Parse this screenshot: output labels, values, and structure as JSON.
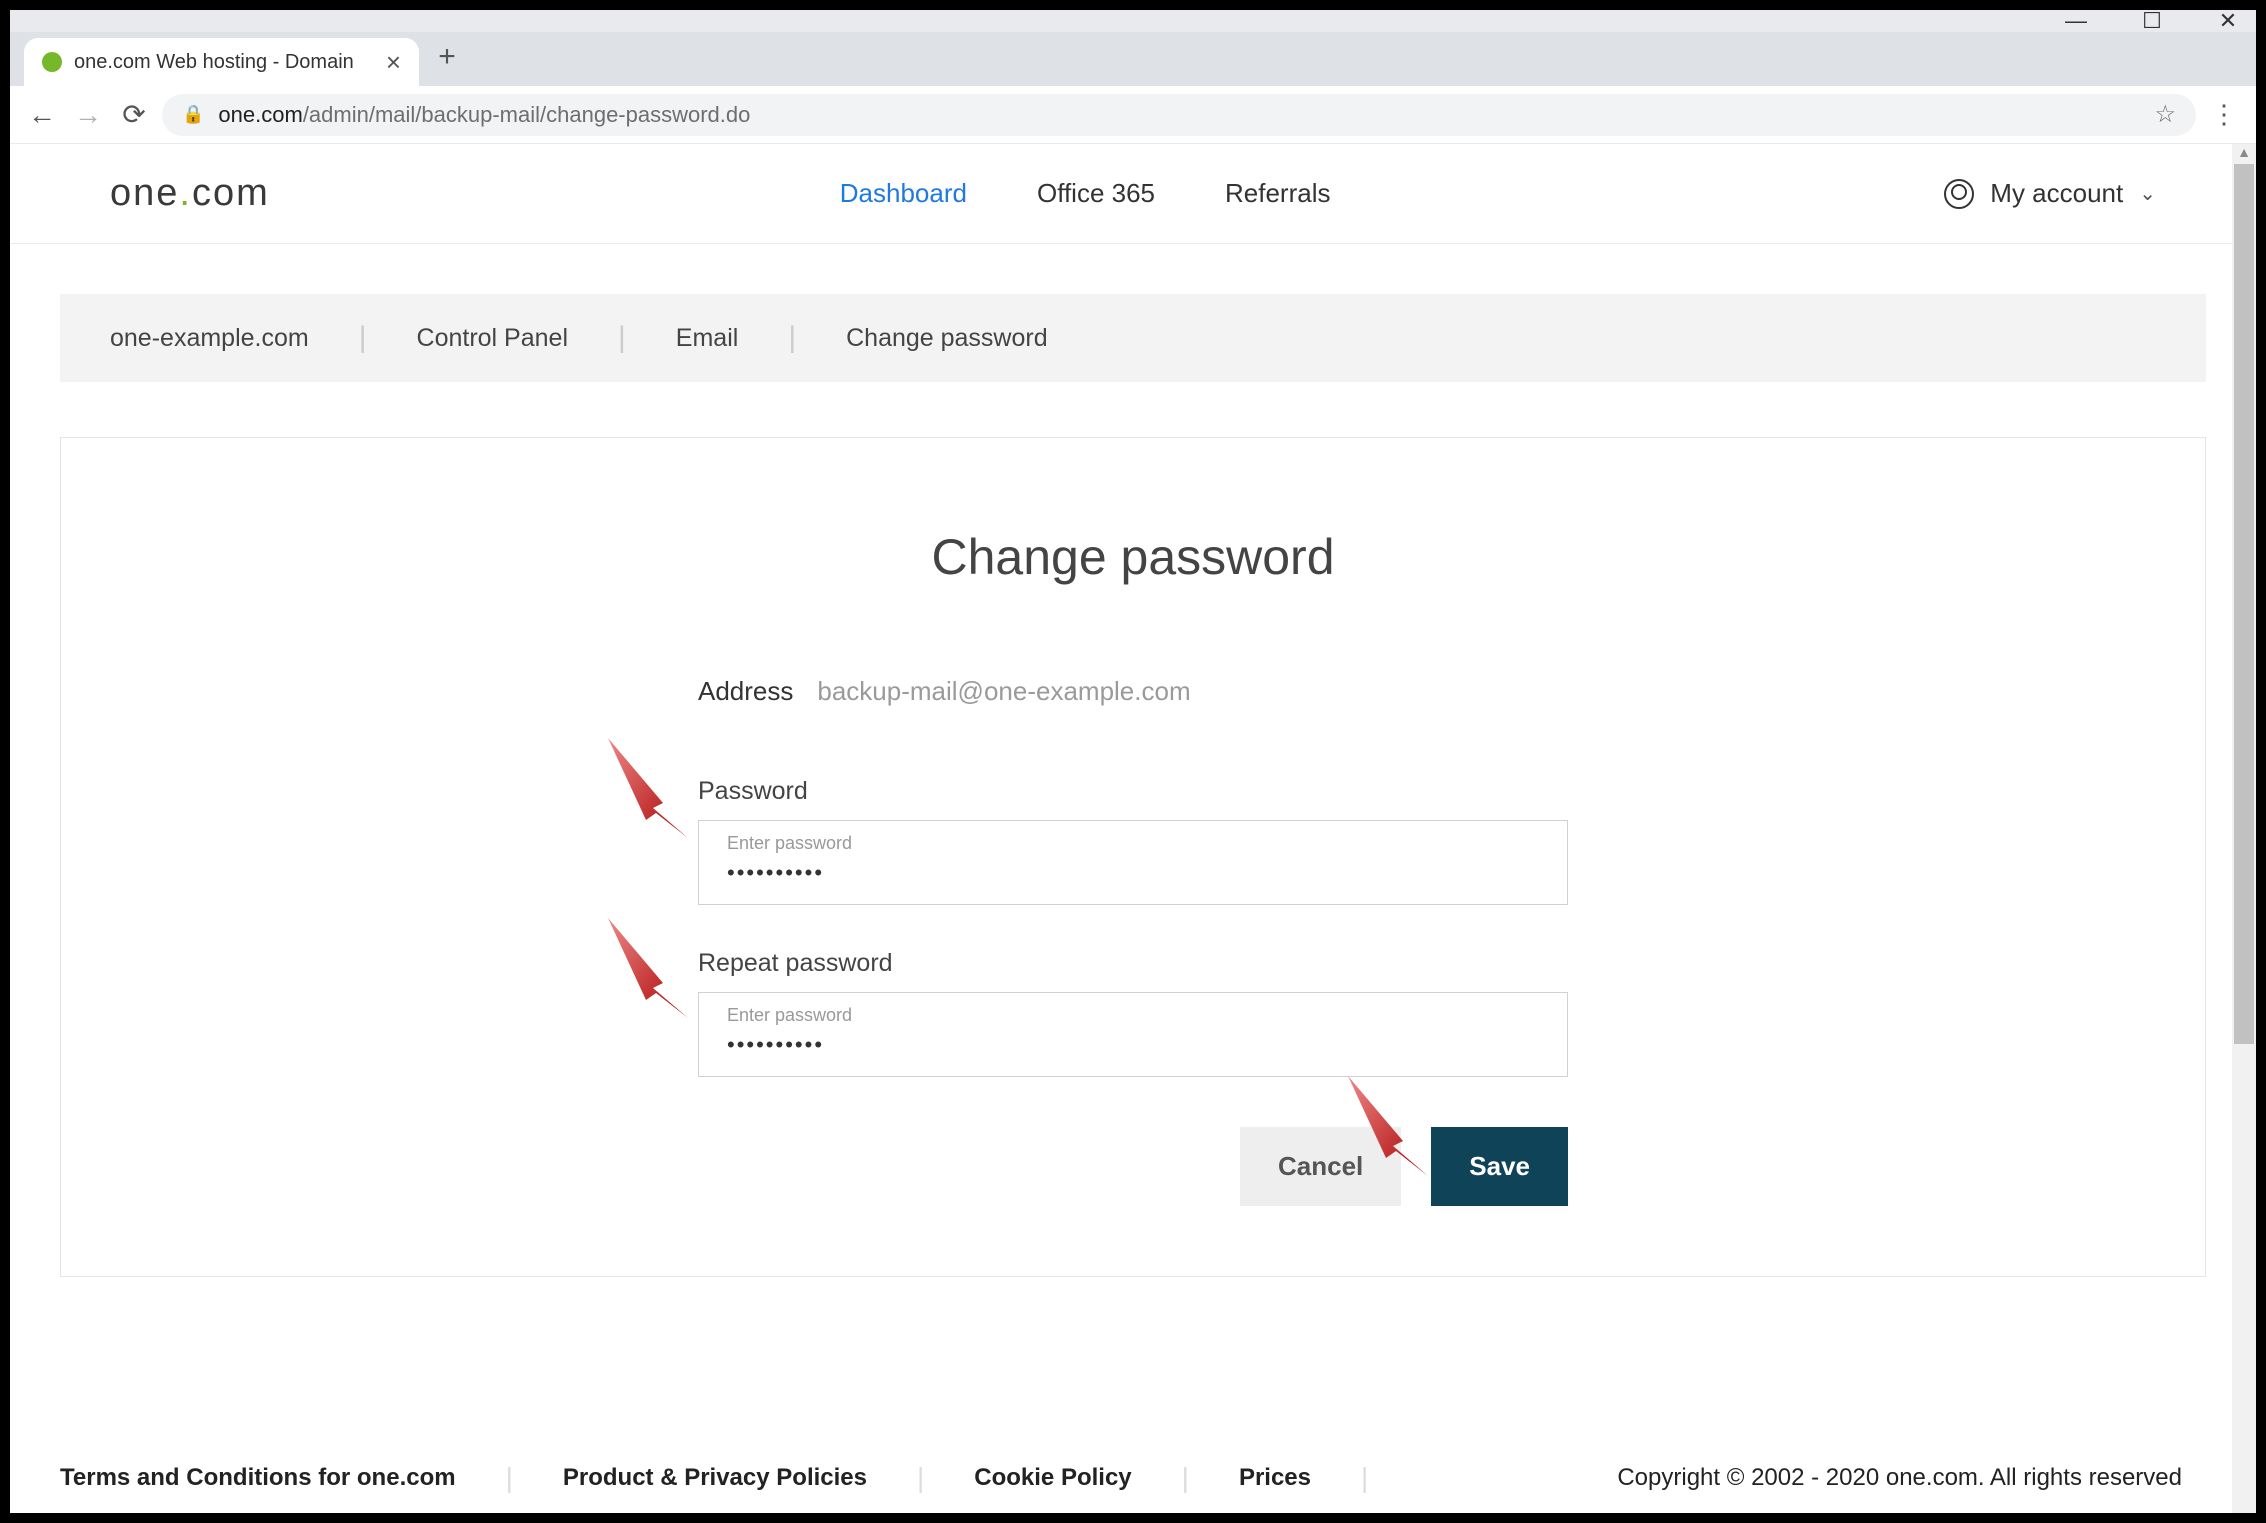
{
  "browser": {
    "tab_title": "one.com Web hosting  -  Domain",
    "url_domain": "one.com",
    "url_path": "/admin/mail/backup-mail/change-password.do"
  },
  "header": {
    "logo_left": "one",
    "logo_right": "com",
    "nav": {
      "dashboard": "Dashboard",
      "office365": "Office 365",
      "referrals": "Referrals"
    },
    "account_label": "My account"
  },
  "breadcrumb": {
    "b0": "one-example.com",
    "b1": "Control Panel",
    "b2": "Email",
    "b3": "Change password"
  },
  "form": {
    "title": "Change password",
    "address_label": "Address",
    "address_value": "backup-mail@one-example.com",
    "password_label": "Password",
    "password_floating": "Enter password",
    "password_value": "••••••••••",
    "repeat_label": "Repeat password",
    "repeat_floating": "Enter password",
    "repeat_value": "••••••••••",
    "cancel": "Cancel",
    "save": "Save"
  },
  "footer": {
    "terms": "Terms and Conditions for one.com",
    "privacy": "Product & Privacy Policies",
    "cookie": "Cookie Policy",
    "prices": "Prices",
    "copyright": "Copyright © 2002 - 2020 one.com. All rights reserved"
  }
}
